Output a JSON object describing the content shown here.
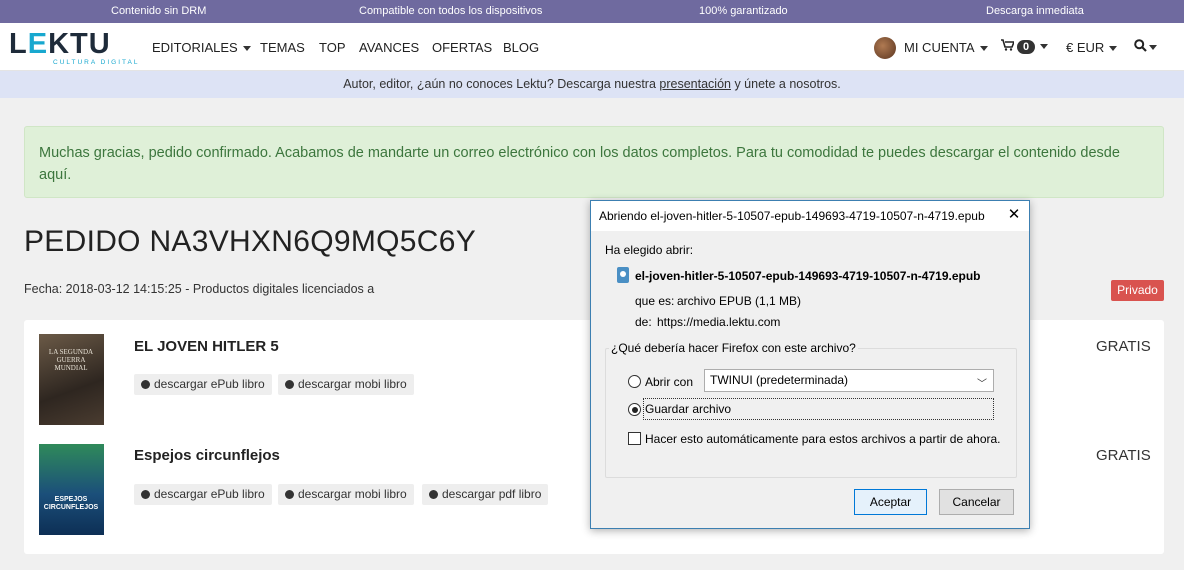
{
  "topbar": {
    "items": [
      "Contenido sin DRM",
      "Compatible con todos los dispositivos",
      "100% garantizado",
      "Descarga inmediata"
    ]
  },
  "nav": {
    "logo": {
      "text_before": "L",
      "text_e": "E",
      "text_after": "KTU",
      "tagline": "CULTURA DIGITAL"
    },
    "menu": [
      "EDITORIALES",
      "TEMAS",
      "TOP",
      "AVANCES",
      "OFERTAS",
      "BLOG"
    ],
    "account_label": "MI CUENTA",
    "cart_count": "0",
    "currency": "€ EUR"
  },
  "banner": {
    "text_before": "Autor, editor, ¿aún no conoces Lektu? Descarga nuestra ",
    "link": "presentación",
    "text_after": " y únete a nosotros."
  },
  "alert": {
    "text": "Muchas gracias, pedido confirmado. Acabamos de mandarte un correo electrónico con los datos completos. Para tu comodidad te puedes descargar el contenido desde aquí."
  },
  "order": {
    "title": "PEDIDO NA3VHXN6Q9MQ5C6Y",
    "date_line": "Fecha: 2018-03-12 14:15:25 - Productos digitales licenciados a",
    "badge": "Privado"
  },
  "items": [
    {
      "title": "EL JOVEN HITLER 5",
      "price": "GRATIS",
      "cover_text": "LA SEGUNDA GUERRA MUNDIAL",
      "downloads": [
        "descargar ePub libro",
        "descargar mobi libro"
      ]
    },
    {
      "title": "Espejos circunflejos",
      "price": "GRATIS",
      "cover_text": "ESPEJOS CIRCUNFLEJOS",
      "downloads": [
        "descargar ePub libro",
        "descargar mobi libro",
        "descargar pdf libro"
      ]
    }
  ],
  "dialog": {
    "title": "Abriendo el-joven-hitler-5-10507-epub-149693-4719-10507-n-4719.epub",
    "intro": "Ha elegido abrir:",
    "filename": "el-joven-hitler-5-10507-epub-149693-4719-10507-n-4719.epub",
    "type_label": "que es:",
    "type_value": "archivo EPUB (1,1 MB)",
    "from_label": "de:",
    "from_value": "https://media.lektu.com",
    "question": "¿Qué debería hacer Firefox con este archivo?",
    "open_with_label": "Abrir con",
    "open_with_app": "TWINUI (predeterminada)",
    "save_label": "Guardar archivo",
    "auto_label": "Hacer esto automáticamente para estos archivos a partir de ahora.",
    "ok_label": "Aceptar",
    "cancel_label": "Cancelar",
    "selected_option": "save"
  }
}
